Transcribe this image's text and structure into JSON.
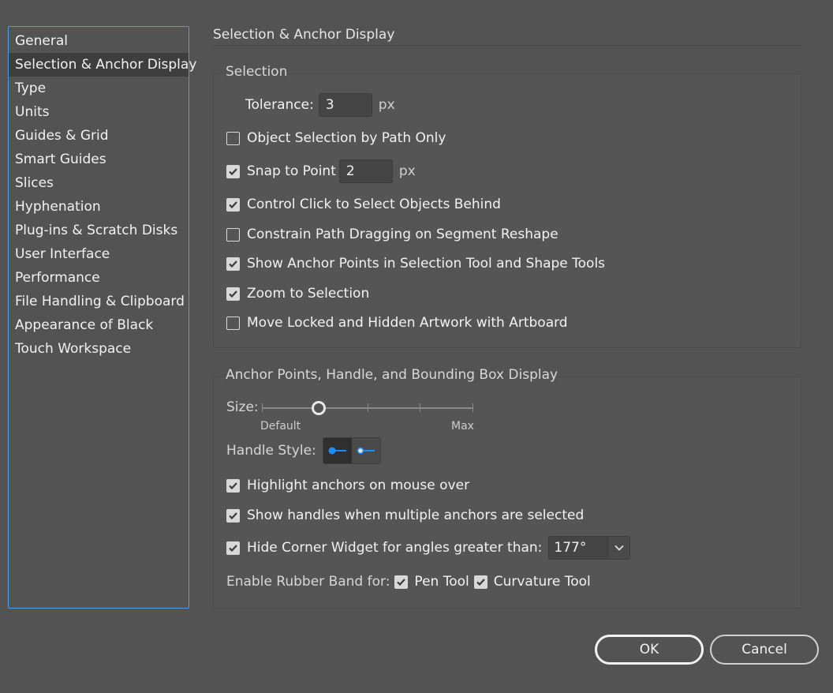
{
  "sidebar": {
    "items": [
      {
        "label": "General"
      },
      {
        "label": "Selection & Anchor Display",
        "selected": true
      },
      {
        "label": "Type"
      },
      {
        "label": "Units"
      },
      {
        "label": "Guides & Grid"
      },
      {
        "label": "Smart Guides"
      },
      {
        "label": "Slices"
      },
      {
        "label": "Hyphenation"
      },
      {
        "label": "Plug-ins & Scratch Disks"
      },
      {
        "label": "User Interface"
      },
      {
        "label": "Performance"
      },
      {
        "label": "File Handling & Clipboard"
      },
      {
        "label": "Appearance of Black"
      },
      {
        "label": "Touch Workspace"
      }
    ]
  },
  "page": {
    "title": "Selection & Anchor Display"
  },
  "selection": {
    "legend": "Selection",
    "tolerance_label": "Tolerance:",
    "tolerance_value": "3",
    "tolerance_unit": "px",
    "object_selection_by_path": {
      "label": "Object Selection by Path Only",
      "checked": false
    },
    "snap_to_point": {
      "label": "Snap to Point",
      "checked": true,
      "value": "2",
      "unit": "px"
    },
    "control_click": {
      "label": "Control Click to Select Objects Behind",
      "checked": true
    },
    "constrain_path": {
      "label": "Constrain Path Dragging on Segment Reshape",
      "checked": false
    },
    "show_anchor_points": {
      "label": "Show Anchor Points in Selection Tool and Shape Tools",
      "checked": true
    },
    "zoom_to_selection": {
      "label": "Zoom to Selection",
      "checked": true
    },
    "move_locked": {
      "label": "Move Locked and Hidden Artwork with Artboard",
      "checked": false
    }
  },
  "anchor_display": {
    "legend": "Anchor Points, Handle, and Bounding Box Display",
    "size_label": "Size:",
    "size_min_label": "Default",
    "size_max_label": "Max",
    "size_level_fraction": 0.27,
    "handle_style_label": "Handle Style:",
    "handle_style_selected": "solid",
    "highlight_anchors": {
      "label": "Highlight anchors on mouse over",
      "checked": true
    },
    "show_handles": {
      "label": "Show handles when multiple anchors are selected",
      "checked": true
    },
    "hide_corner_widget": {
      "label": "Hide Corner Widget for angles greater than:",
      "checked": true,
      "value": "177°"
    },
    "rubber_band_label": "Enable Rubber Band for:",
    "pen_tool": {
      "label": "Pen Tool",
      "checked": true
    },
    "curvature_tool": {
      "label": "Curvature Tool",
      "checked": true
    }
  },
  "buttons": {
    "ok": "OK",
    "cancel": "Cancel"
  },
  "colors": {
    "background": "#535353",
    "sidebar_border": "#4a9be8",
    "handle_blue": "#1e8cff"
  }
}
